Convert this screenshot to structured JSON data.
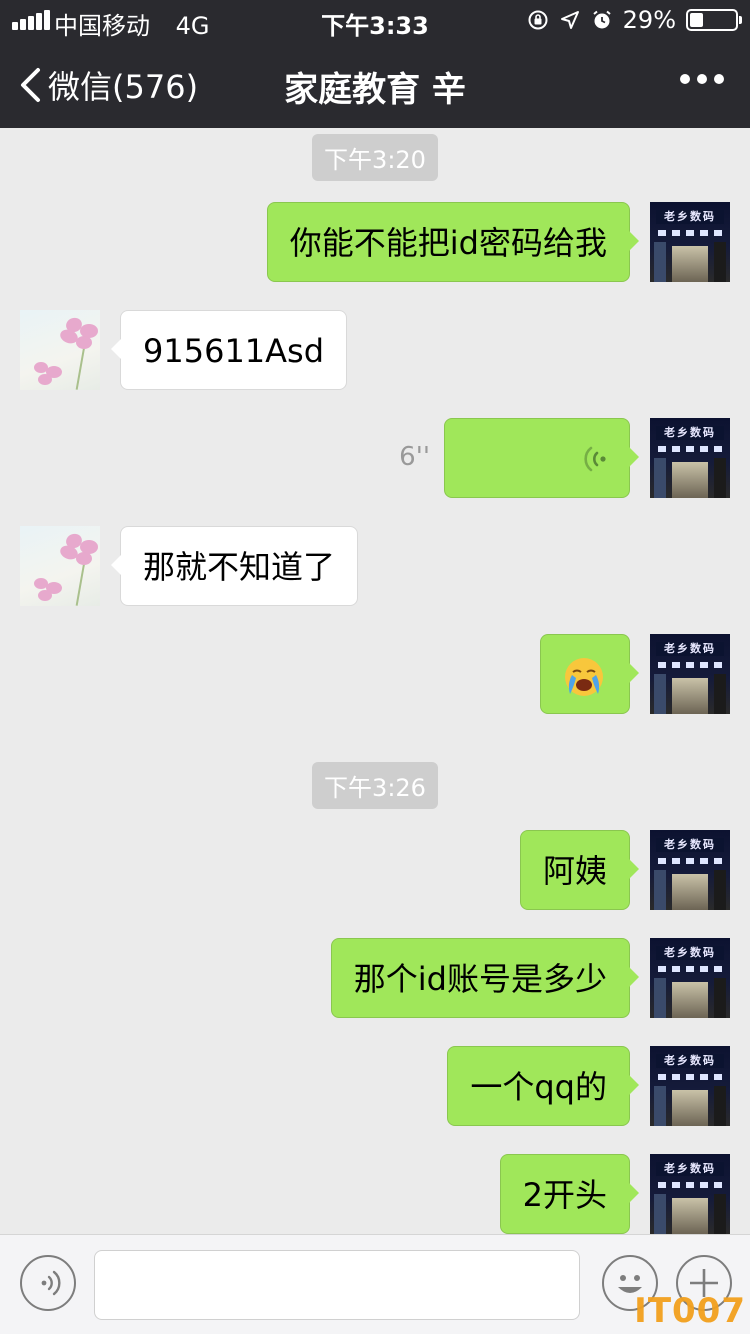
{
  "status_bar": {
    "carrier": "中国移动",
    "network": "4G",
    "time": "下午3:33",
    "battery": "29%",
    "battery_level": 0.29
  },
  "nav": {
    "back_label": "微信(576)",
    "title": "家庭教育 辛",
    "more_icon": "more-icon"
  },
  "messages": [
    {
      "type": "timestamp",
      "text": "下午3:20"
    },
    {
      "type": "text",
      "side": "out",
      "text": "你能不能把id密码给我"
    },
    {
      "type": "text",
      "side": "in",
      "text": "915611Asd"
    },
    {
      "type": "voice",
      "side": "out",
      "duration": "6''"
    },
    {
      "type": "text",
      "side": "in",
      "text": "那就不知道了"
    },
    {
      "type": "emoji",
      "side": "out",
      "emoji": "loudly-crying-face"
    },
    {
      "type": "timestamp",
      "text": "下午3:26"
    },
    {
      "type": "text",
      "side": "out",
      "text": "阿姨"
    },
    {
      "type": "text",
      "side": "out",
      "text": "那个id账号是多少"
    },
    {
      "type": "text",
      "side": "out",
      "text": "一个qq的"
    },
    {
      "type": "text",
      "side": "out",
      "text": "2开头"
    }
  ],
  "avatars": {
    "self_sign": "老乡数码"
  },
  "input_bar": {
    "value": "",
    "voice_icon": "voice-icon",
    "emoji_icon": "emoji-icon",
    "plus_icon": "plus-icon"
  },
  "watermark": "IT007",
  "colors": {
    "nav_bg": "#2a2a2f",
    "chat_bg": "#ebebeb",
    "out_bubble": "#a0e75a",
    "in_bubble": "#ffffff",
    "timestamp_bg": "#cecece"
  }
}
